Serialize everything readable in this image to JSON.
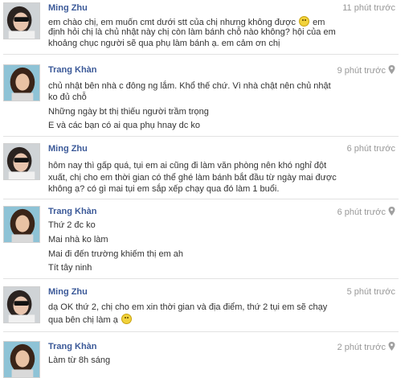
{
  "messages": [
    {
      "author": "Ming Zhu",
      "time": "11 phút trước",
      "location_icon": "",
      "lines": [
        "em chào chị, em muốn cmt dưới stt của chị nhưng không được",
        "định hỏi chị là chủ nhật này chị còn làm bánh chỗ nào không? hội của em",
        "khoảng chục người sẽ qua phụ làm bánh ạ. em cảm ơn chị"
      ],
      "line1_tail": "em",
      "emoticon": "smile-emoticon"
    },
    {
      "author": "Trang Khàn",
      "time": "9 phút trước",
      "location_icon": "map-pin-icon",
      "lines": [
        "chủ nhật bên nhà c đông ng lắm. Khổ thế chứ. Vì nhà chật nên chủ nhật",
        "ko đủ chỗ",
        "Những ngày bt thị thiếu người trầm trọng",
        "E và các bạn có ai qua phụ hnay dc ko"
      ]
    },
    {
      "author": "Ming Zhu",
      "time": "6 phút trước",
      "location_icon": "",
      "lines": [
        "hôm nay thì gấp quá, tụi em ai cũng đi làm văn phòng nên khó nghỉ đột",
        "xuất, chị cho em thời gian có thể ghé làm bánh bắt đầu từ ngày mai được",
        "không ạ? có gì mai tụi em sắp xếp chạy qua đó làm 1 buổi."
      ]
    },
    {
      "author": "Trang Khàn",
      "time": "6 phút trước",
      "location_icon": "map-pin-icon",
      "lines": [
        "Thứ 2 đc ko",
        "Mai nhà ko làm",
        "Mai đi đến trường khiếm thị em ah",
        "Tít tây ninh"
      ]
    },
    {
      "author": "Ming Zhu",
      "time": "5 phút trước",
      "location_icon": "",
      "lines": [
        "dạ OK thứ 2, chị cho em xin thời gian và địa điểm, thứ 2 tụi em sẽ chạy",
        "qua bên chị làm ạ"
      ],
      "emoticon": "smile-emoticon"
    },
    {
      "author": "Trang Khàn",
      "time": "2 phút trước",
      "location_icon": "map-pin-icon",
      "lines": [
        "Làm từ 8h sáng"
      ]
    }
  ],
  "colors": {
    "author": "#3b5998",
    "time": "#999999",
    "text": "#333333",
    "separator": "#e2e2e2"
  }
}
